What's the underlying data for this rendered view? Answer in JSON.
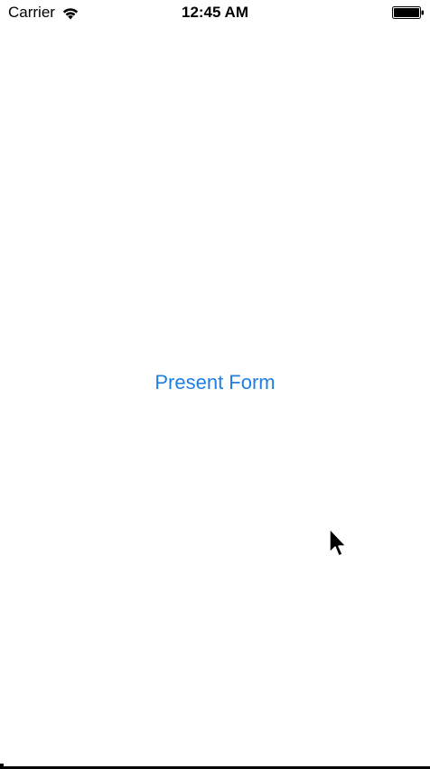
{
  "status_bar": {
    "carrier": "Carrier",
    "time": "12:45 AM",
    "wifi_icon": "wifi-icon",
    "battery_icon": "battery-icon",
    "battery_level": 1.0
  },
  "main": {
    "present_form_label": "Present Form"
  },
  "colors": {
    "accent": "#1f7fe0",
    "background": "#ffffff",
    "status_text": "#000000"
  },
  "pointer": {
    "icon": "mouse-cursor-icon"
  }
}
